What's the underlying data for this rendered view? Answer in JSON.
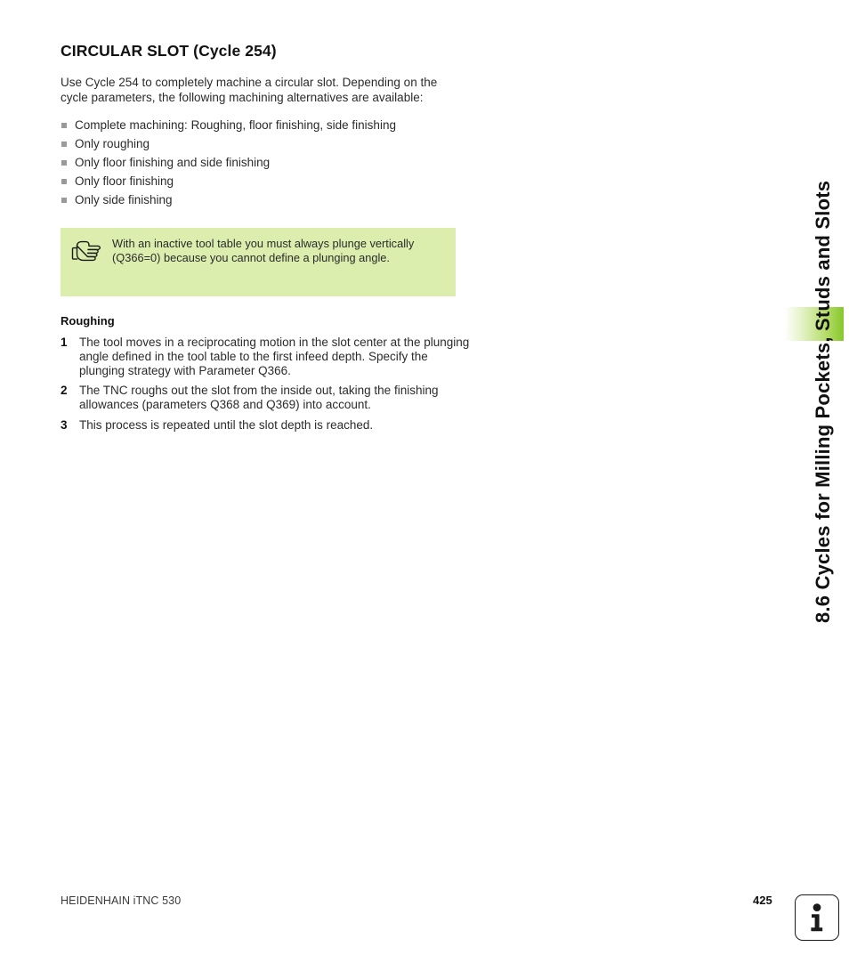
{
  "page": {
    "title": "CIRCULAR SLOT (Cycle 254)",
    "intro": "Use Cycle 254 to completely machine a circular slot. Depending on the cycle parameters, the following machining alternatives are available:"
  },
  "alternatives": [
    {
      "label": "Complete machining: Roughing, floor finishing, side finishing"
    },
    {
      "label": "Only roughing"
    },
    {
      "label": "Only floor finishing and side finishing"
    },
    {
      "label": "Only floor finishing"
    },
    {
      "label": "Only side finishing"
    }
  ],
  "note": {
    "icon": "pointing-hand-icon",
    "text": "With an inactive tool table you must always plunge vertically (Q366=0) because you cannot define a plunging angle.",
    "background_color": "#dbeeae"
  },
  "roughing": {
    "heading": "Roughing",
    "steps": [
      {
        "num": "1",
        "text": "The tool moves in a reciprocating motion in the slot center at the plunging angle defined in the tool table to the first infeed depth. Specify the plunging strategy with Parameter Q366."
      },
      {
        "num": "2",
        "text": "The TNC roughs out the slot from the inside out, taking the finishing allowances (parameters Q368 and Q369) into account."
      },
      {
        "num": "3",
        "text": "This process is repeated until the slot depth is reached."
      }
    ]
  },
  "sidebar": {
    "chapter_title": "8.6 Cycles for Milling Pockets, Studs and Slots",
    "tab_color": "#86c72b"
  },
  "footer": {
    "product": "HEIDENHAIN iTNC 530",
    "page_number": "425",
    "info_icon": "info-i-icon"
  }
}
